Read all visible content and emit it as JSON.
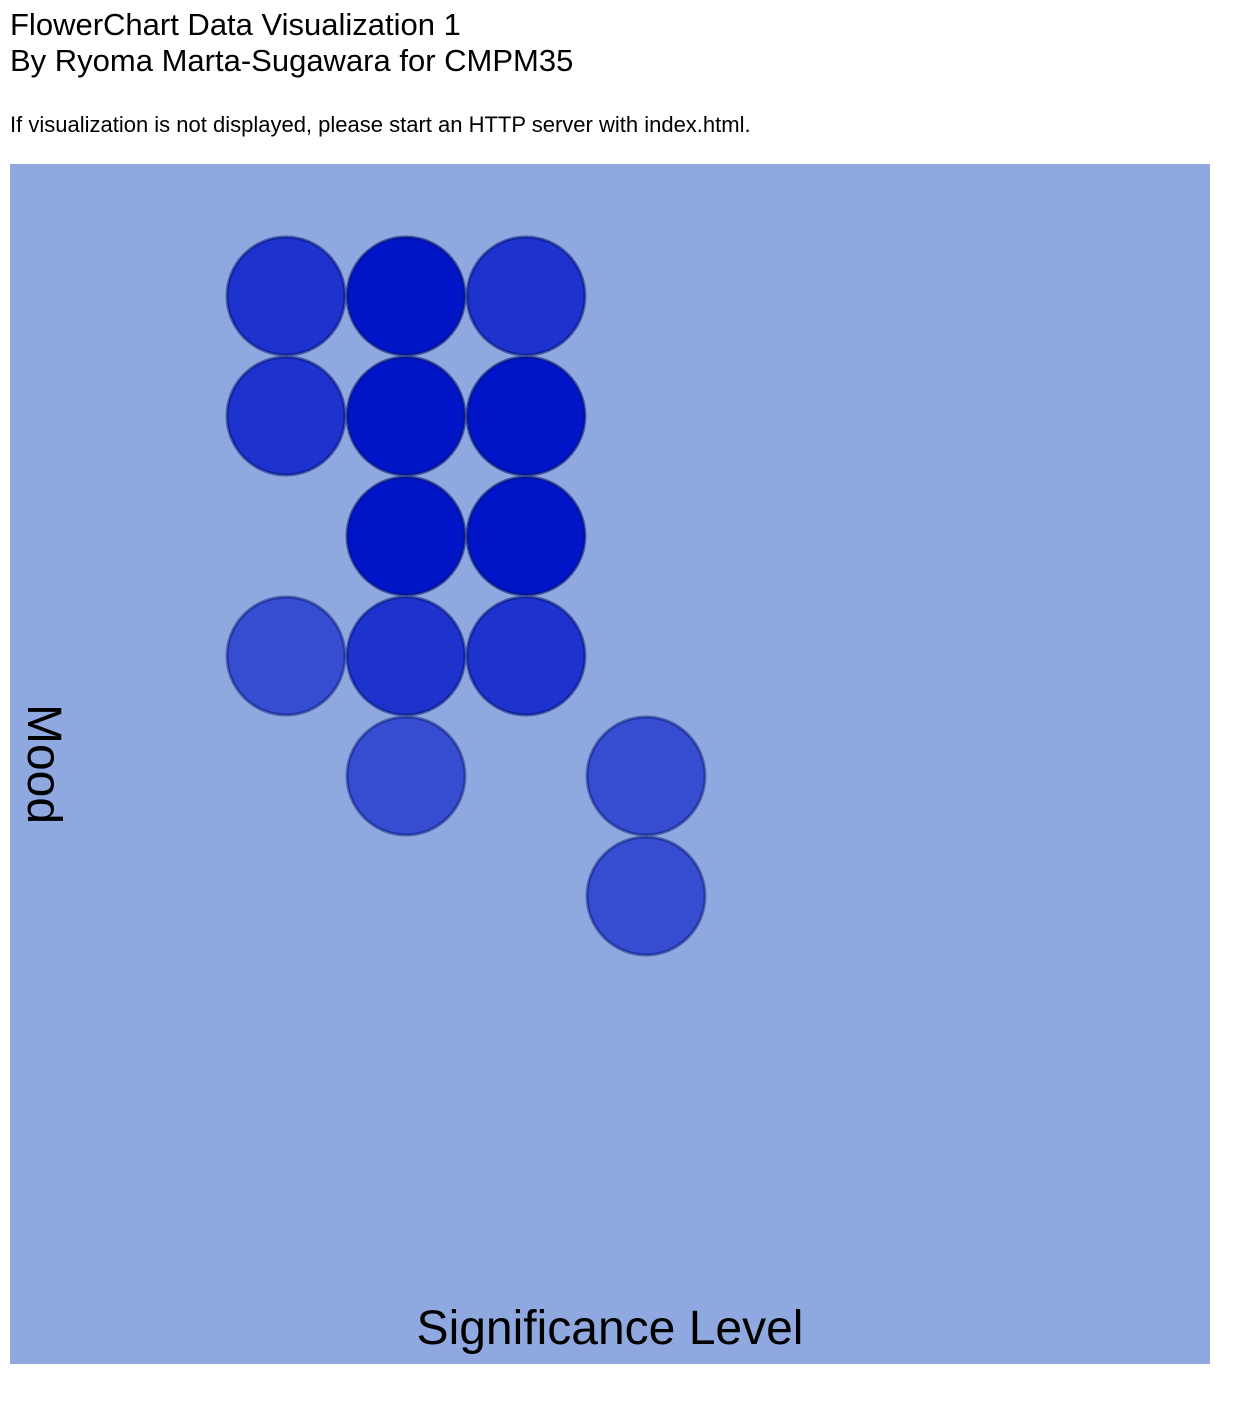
{
  "header": {
    "title": "FlowerChart Data Visualization 1",
    "subtitle": "By Ryoma Marta-Sugawara for CMPM35",
    "notice": "If visualization is not displayed, please start an HTTP server with index.html."
  },
  "chart_data": {
    "type": "heatmap",
    "title": "FlowerChart Data Visualization 1",
    "xlabel": "Significance Level",
    "ylabel": "Mood",
    "grid": false,
    "legend": "none",
    "background_color": "#8FA9E0",
    "mark_color": "#0014C8",
    "grid_columns": 10,
    "grid_rows": 10,
    "points": [
      {
        "col": 1,
        "row": 0,
        "intensity": 0.85
      },
      {
        "col": 2,
        "row": 0,
        "intensity": 1.0
      },
      {
        "col": 3,
        "row": 0,
        "intensity": 0.85
      },
      {
        "col": 1,
        "row": 1,
        "intensity": 0.85
      },
      {
        "col": 2,
        "row": 1,
        "intensity": 1.0
      },
      {
        "col": 3,
        "row": 1,
        "intensity": 1.0
      },
      {
        "col": 2,
        "row": 2,
        "intensity": 1.0
      },
      {
        "col": 3,
        "row": 2,
        "intensity": 1.0
      },
      {
        "col": 1,
        "row": 3,
        "intensity": 0.7
      },
      {
        "col": 2,
        "row": 3,
        "intensity": 0.85
      },
      {
        "col": 3,
        "row": 3,
        "intensity": 0.85
      },
      {
        "col": 2,
        "row": 4,
        "intensity": 0.7
      },
      {
        "col": 4,
        "row": 4,
        "intensity": 0.7
      },
      {
        "col": 4,
        "row": 5,
        "intensity": 0.7
      }
    ]
  }
}
